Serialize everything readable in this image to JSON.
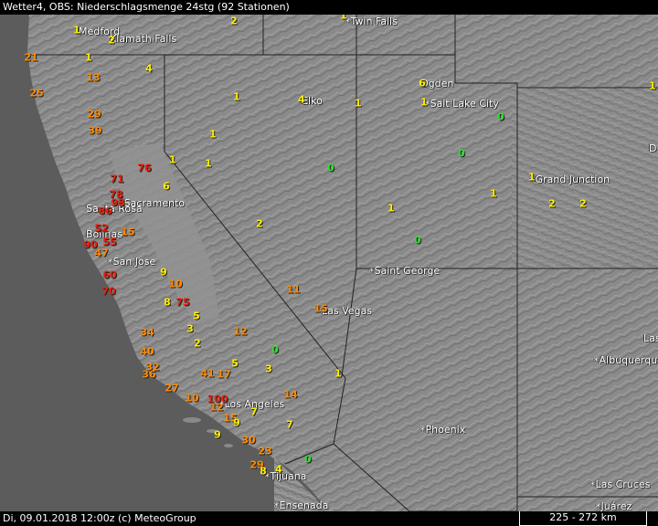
{
  "header": {
    "title": "Wetter4, OBS: Niederschlagsmenge 24stg (92 Stationen)"
  },
  "footer": {
    "status": "Di, 09.01.2018 12:00z (c) MeteoGroup",
    "scale": "225 - 272 km"
  },
  "colors": {
    "zero": "#33dd33",
    "low": "#ffee00",
    "mid": "#ff8a00",
    "high": "#e8200f",
    "ocean": "#5c5c5c",
    "land": "#8a8a8a"
  },
  "cities": [
    {
      "name": "Medford"
    },
    {
      "name": "Klamath Falls"
    },
    {
      "name": "Twin Falls"
    },
    {
      "name": "Ogden"
    },
    {
      "name": "Elko"
    },
    {
      "name": "Salt Lake City"
    },
    {
      "name": "Sacramento"
    },
    {
      "name": "Santa Rosa"
    },
    {
      "name": "Bolinas"
    },
    {
      "name": "San Jose"
    },
    {
      "name": "Grand Junction"
    },
    {
      "name": "Saint George"
    },
    {
      "name": "Las Vegas"
    },
    {
      "name": "Los Angeles"
    },
    {
      "name": "Phoenix"
    },
    {
      "name": "Tijuana"
    },
    {
      "name": "Ensenada"
    },
    {
      "name": "Albuquerque"
    },
    {
      "name": "Las Cruces"
    },
    {
      "name": "Juárez"
    },
    {
      "name": "Las"
    },
    {
      "name": "D"
    }
  ],
  "stations": [
    {
      "value": "2"
    },
    {
      "value": "1"
    },
    {
      "value": "2"
    },
    {
      "value": "1"
    },
    {
      "value": "1"
    },
    {
      "value": "6"
    },
    {
      "value": "1"
    },
    {
      "value": "21"
    },
    {
      "value": "1"
    },
    {
      "value": "4"
    },
    {
      "value": "13"
    },
    {
      "value": "25"
    },
    {
      "value": "1"
    },
    {
      "value": "4"
    },
    {
      "value": "1"
    },
    {
      "value": "0"
    },
    {
      "value": "29"
    },
    {
      "value": "39"
    },
    {
      "value": "1"
    },
    {
      "value": "0"
    },
    {
      "value": "1"
    },
    {
      "value": "1"
    },
    {
      "value": "0"
    },
    {
      "value": "76"
    },
    {
      "value": "71"
    },
    {
      "value": "1"
    },
    {
      "value": "2"
    },
    {
      "value": "6"
    },
    {
      "value": "2"
    },
    {
      "value": "78"
    },
    {
      "value": "98"
    },
    {
      "value": "1"
    },
    {
      "value": "86"
    },
    {
      "value": "1"
    },
    {
      "value": "52"
    },
    {
      "value": "15"
    },
    {
      "value": "2"
    },
    {
      "value": "0"
    },
    {
      "value": "90"
    },
    {
      "value": "47"
    },
    {
      "value": "55"
    },
    {
      "value": "9"
    },
    {
      "value": "10"
    },
    {
      "value": "60"
    },
    {
      "value": "11"
    },
    {
      "value": "70"
    },
    {
      "value": "8"
    },
    {
      "value": "75"
    },
    {
      "value": "15"
    },
    {
      "value": "5"
    },
    {
      "value": "34"
    },
    {
      "value": "3"
    },
    {
      "value": "12"
    },
    {
      "value": "2"
    },
    {
      "value": "40"
    },
    {
      "value": "0"
    },
    {
      "value": "5"
    },
    {
      "value": "3"
    },
    {
      "value": "32"
    },
    {
      "value": "36"
    },
    {
      "value": "41"
    },
    {
      "value": "17"
    },
    {
      "value": "1"
    },
    {
      "value": "27"
    },
    {
      "value": "10"
    },
    {
      "value": "100"
    },
    {
      "value": "12"
    },
    {
      "value": "14"
    },
    {
      "value": "15"
    },
    {
      "value": "9"
    },
    {
      "value": "7"
    },
    {
      "value": "7"
    },
    {
      "value": "9"
    },
    {
      "value": "30"
    },
    {
      "value": "23"
    },
    {
      "value": "29"
    },
    {
      "value": "0"
    },
    {
      "value": "8"
    },
    {
      "value": "4"
    }
  ]
}
